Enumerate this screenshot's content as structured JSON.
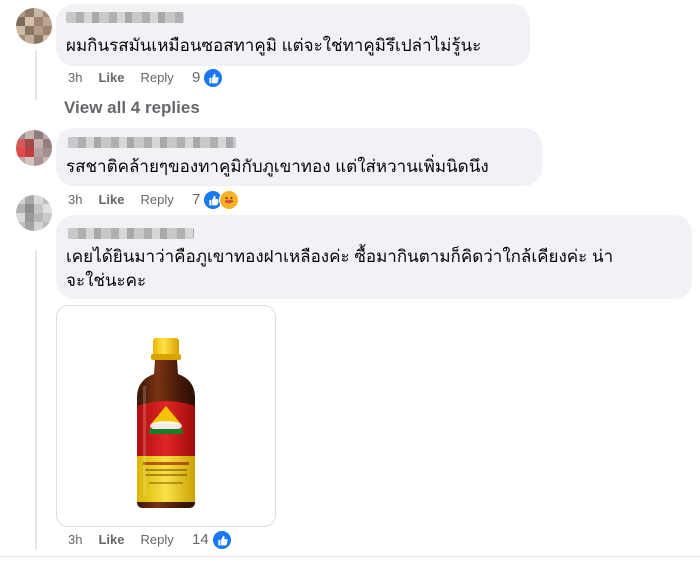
{
  "comments": [
    {
      "text": "ผมกินรสมันเหมือนซอสทาคูมิ แต่จะใช่ทาคูมิรึเปล่าไม่รู้นะ",
      "time": "3h",
      "like": "Like",
      "reply": "Reply",
      "reactions": "9",
      "reaction_icons": [
        "like-icon"
      ]
    },
    {
      "text": "รสชาติคล้ายๆของทาคูมิกับภูเขาทอง แต่ใส่หวานเพิ่มนิดนึง",
      "time": "3h",
      "like": "Like",
      "reply": "Reply",
      "reactions": "7",
      "reaction_icons": [
        "like-icon",
        "care-icon"
      ]
    },
    {
      "text_line1": "เคยได้ยินมาว่าคือภูเขาทองฝาเหลืองค่ะ ซื้อมากินตามก็คิดว่าใกล้เคียงค่ะ น่า",
      "text_line2": "จะใช่นะคะ",
      "time": "3h",
      "like": "Like",
      "reply": "Reply",
      "reactions": "14",
      "reaction_icons": [
        "like-icon"
      ],
      "image": "sauce-bottle"
    }
  ],
  "view_replies": "View all 4 replies",
  "colors": {
    "bubble": "#f0f2f5",
    "like_blue": "#1877f2",
    "muted": "#65676b"
  }
}
